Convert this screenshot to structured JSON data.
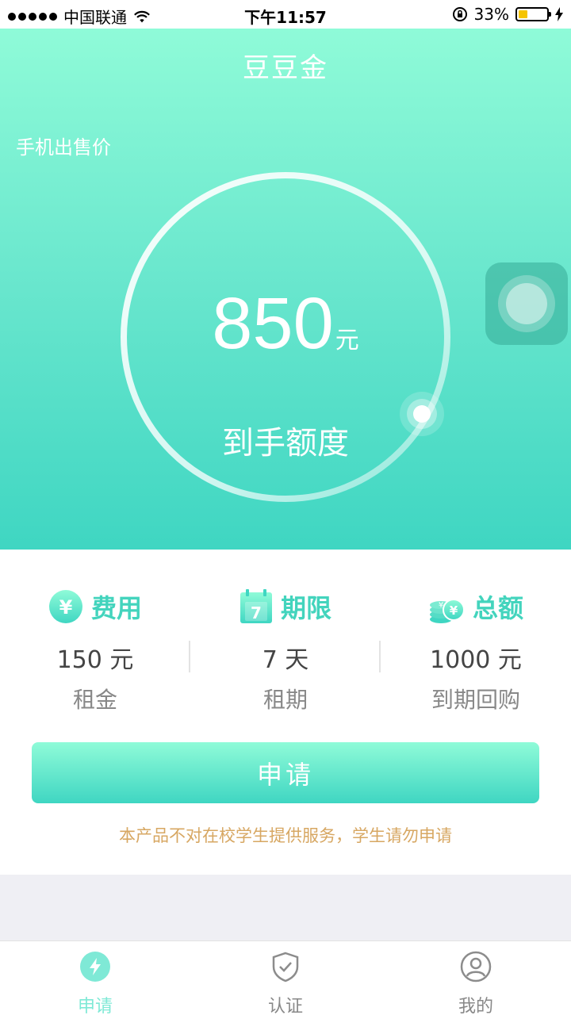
{
  "status_bar": {
    "carrier": "中国联通",
    "time": "下午11:57",
    "battery": "33%",
    "battery_level": 0.33
  },
  "header": {
    "title": "豆豆金",
    "price_label": "手机出售价"
  },
  "gauge": {
    "amount": "850",
    "unit": "元",
    "label": "到手额度"
  },
  "summary": [
    {
      "title": "费用",
      "icon": "yen-coin-icon",
      "value": "150 元",
      "sub": "租金"
    },
    {
      "title": "期限",
      "icon": "calendar-icon",
      "calendar_day": "7",
      "value": "7 天",
      "sub": "租期"
    },
    {
      "title": "总额",
      "icon": "coin-stack-icon",
      "value": "1000 元",
      "sub": "到期回购"
    }
  ],
  "apply_button": "申请",
  "notice": "本产品不对在校学生提供服务，学生请勿申请",
  "tabs": [
    {
      "label": "申请",
      "icon": "lightning-icon",
      "active": true
    },
    {
      "label": "认证",
      "icon": "shield-check-icon",
      "active": false
    },
    {
      "label": "我的",
      "icon": "user-icon",
      "active": false
    }
  ],
  "colors": {
    "accent": "#43d4bd",
    "gradient_top": "#8ffbd8",
    "gradient_bottom": "#3fd6c2",
    "notice": "#d7a762"
  }
}
